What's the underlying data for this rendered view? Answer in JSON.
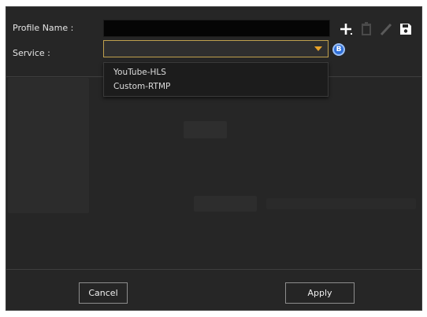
{
  "form": {
    "profile_name_label": "Profile Name :",
    "profile_name_value": "",
    "service_label": "Service :",
    "service_selected": "",
    "service_options": [
      "YouTube-HLS",
      "Custom-RTMP"
    ]
  },
  "info_badge": "B",
  "toolbar_icons": [
    "add-icon",
    "delete-icon",
    "edit-icon",
    "save-icon"
  ],
  "footer": {
    "cancel_label": "Cancel",
    "apply_label": "Apply"
  },
  "colors": {
    "dialog_bg": "#262626",
    "select_border": "#bfa04e",
    "caret": "#e7a229",
    "info_badge": "#2f6fd8"
  }
}
